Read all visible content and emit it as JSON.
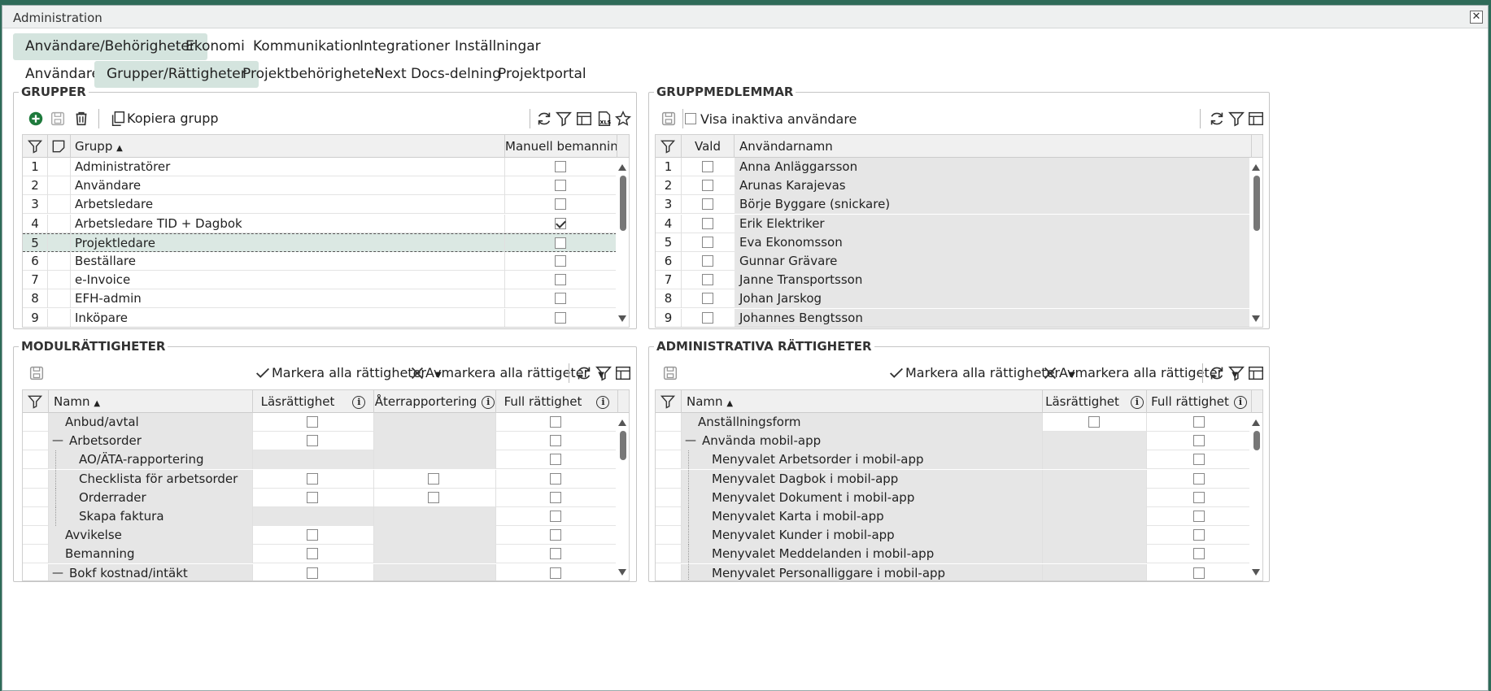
{
  "window": {
    "title": "Administration",
    "close": "✕"
  },
  "main_tabs": [
    "Användare/Behörigheter",
    "Ekonomi",
    "Kommunikation",
    "Integrationer",
    "Inställningar"
  ],
  "sub_tabs": [
    "Användare",
    "Grupper/Rättigheter",
    "Projektbehörigheter",
    "Next Docs-delning",
    "Projektportal"
  ],
  "groups": {
    "title": "GRUPPER",
    "copy_label": "Kopiera grupp",
    "col_name": "Grupp",
    "col_manual": "Manuell bemanning",
    "rows": [
      {
        "n": "1",
        "name": "Administratörer",
        "manual": false
      },
      {
        "n": "2",
        "name": "Användare",
        "manual": false
      },
      {
        "n": "3",
        "name": "Arbetsledare",
        "manual": false
      },
      {
        "n": "4",
        "name": "Arbetsledare TID + Dagbok",
        "manual": true
      },
      {
        "n": "5",
        "name": "Projektledare",
        "manual": false
      },
      {
        "n": "6",
        "name": "Beställare",
        "manual": false
      },
      {
        "n": "7",
        "name": "e-Invoice",
        "manual": false
      },
      {
        "n": "8",
        "name": "EFH-admin",
        "manual": false
      },
      {
        "n": "9",
        "name": "Inköpare",
        "manual": false
      }
    ]
  },
  "members": {
    "title": "GRUPPMEDLEMMAR",
    "show_inactive": "Visa inaktiva användare",
    "col_sel": "Vald",
    "col_user": "Användarnamn",
    "rows": [
      {
        "n": "1",
        "name": "Anna Anläggarsson"
      },
      {
        "n": "2",
        "name": "Arunas Karajevas"
      },
      {
        "n": "3",
        "name": "Börje Byggare (snickare)"
      },
      {
        "n": "4",
        "name": "Erik Elektriker"
      },
      {
        "n": "5",
        "name": "Eva Ekonomsson"
      },
      {
        "n": "6",
        "name": "Gunnar Grävare"
      },
      {
        "n": "7",
        "name": "Janne Transportsson"
      },
      {
        "n": "8",
        "name": "Johan Jarskog"
      },
      {
        "n": "9",
        "name": "Johannes Bengtsson"
      }
    ]
  },
  "modules": {
    "title": "MODULRÄTTIGHETER",
    "mark_all": "Markera alla rättigheter",
    "unmark_all": "Avmarkera alla rättigeter",
    "col_name": "Namn",
    "col_read": "Läsrättighet",
    "col_report": "Återrapportering",
    "col_full": "Full rättighet",
    "rows": [
      {
        "name": "Anbud/avtal",
        "level": 0,
        "exp": "",
        "read": true,
        "report": false,
        "full": true
      },
      {
        "name": "Arbetsorder",
        "level": 0,
        "exp": "—",
        "read": true,
        "report": false,
        "full": true
      },
      {
        "name": "AO/ÄTA-rapportering",
        "level": 1,
        "exp": "",
        "read": false,
        "report": false,
        "full": true
      },
      {
        "name": "Checklista för arbetsorder",
        "level": 1,
        "exp": "",
        "read": true,
        "report": true,
        "full": true
      },
      {
        "name": "Orderrader",
        "level": 1,
        "exp": "",
        "read": true,
        "report": true,
        "full": true
      },
      {
        "name": "Skapa faktura",
        "level": 1,
        "exp": "",
        "read": false,
        "report": false,
        "full": true
      },
      {
        "name": "Avvikelse",
        "level": 0,
        "exp": "",
        "read": true,
        "report": false,
        "full": true
      },
      {
        "name": "Bemanning",
        "level": 0,
        "exp": "",
        "read": true,
        "report": false,
        "full": true
      },
      {
        "name": "Bokf kostnad/intäkt",
        "level": 0,
        "exp": "—",
        "read": true,
        "report": false,
        "full": true
      }
    ]
  },
  "admin": {
    "title": "ADMINISTRATIVA RÄTTIGHETER",
    "mark_all": "Markera alla rättigheter",
    "unmark_all": "Avmarkera alla rättigeter",
    "col_name": "Namn",
    "col_read": "Läsrättighet",
    "col_full": "Full rättighet",
    "rows": [
      {
        "name": "Anställningsform",
        "level": 0,
        "exp": "",
        "read": true
      },
      {
        "name": "Använda mobil-app",
        "level": 0,
        "exp": "—",
        "read": false
      },
      {
        "name": "Menyvalet Arbetsorder i mobil-app",
        "level": 1,
        "exp": "",
        "read": false
      },
      {
        "name": "Menyvalet Dagbok i mobil-app",
        "level": 1,
        "exp": "",
        "read": false
      },
      {
        "name": "Menyvalet Dokument i mobil-app",
        "level": 1,
        "exp": "",
        "read": false
      },
      {
        "name": "Menyvalet Karta i mobil-app",
        "level": 1,
        "exp": "",
        "read": false
      },
      {
        "name": "Menyvalet Kunder i mobil-app",
        "level": 1,
        "exp": "",
        "read": false
      },
      {
        "name": "Menyvalet Meddelanden i mobil-app",
        "level": 1,
        "exp": "",
        "read": false
      },
      {
        "name": "Menyvalet Personalliggare i mobil-app",
        "level": 1,
        "exp": "",
        "read": false
      }
    ]
  },
  "colors": {
    "accent": "#2e6b58",
    "active_tab": "#d4e4de",
    "add_green": "#1e7a3c"
  }
}
